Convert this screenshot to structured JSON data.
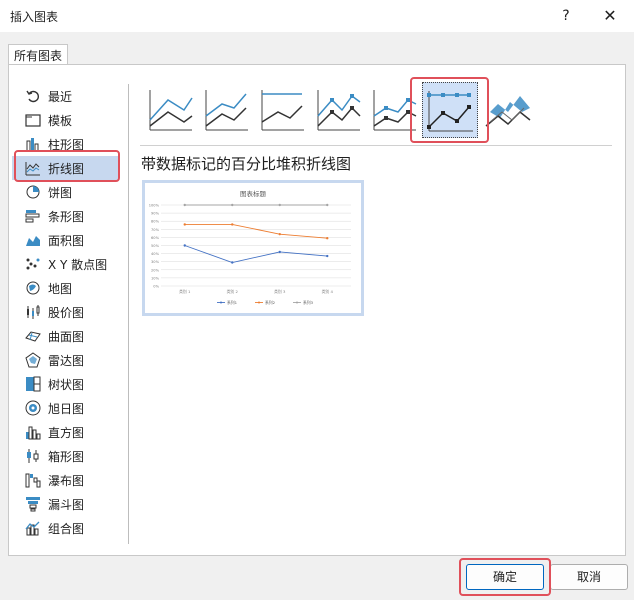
{
  "window": {
    "title": "插入图表",
    "help_label": "?",
    "close_label": "✕"
  },
  "tabs": [
    {
      "label": "所有图表"
    }
  ],
  "sidebar": {
    "items": [
      {
        "label": "最近",
        "icon": "recent-icon"
      },
      {
        "label": "模板",
        "icon": "folder-icon"
      },
      {
        "label": "柱形图",
        "icon": "column-chart-icon"
      },
      {
        "label": "折线图",
        "icon": "line-chart-icon",
        "selected": true
      },
      {
        "label": "饼图",
        "icon": "pie-chart-icon"
      },
      {
        "label": "条形图",
        "icon": "bar-chart-icon"
      },
      {
        "label": "面积图",
        "icon": "area-chart-icon"
      },
      {
        "label": "X Y 散点图",
        "icon": "scatter-chart-icon"
      },
      {
        "label": "地图",
        "icon": "map-chart-icon"
      },
      {
        "label": "股价图",
        "icon": "stock-chart-icon"
      },
      {
        "label": "曲面图",
        "icon": "surface-chart-icon"
      },
      {
        "label": "雷达图",
        "icon": "radar-chart-icon"
      },
      {
        "label": "树状图",
        "icon": "treemap-chart-icon"
      },
      {
        "label": "旭日图",
        "icon": "sunburst-chart-icon"
      },
      {
        "label": "直方图",
        "icon": "histogram-chart-icon"
      },
      {
        "label": "箱形图",
        "icon": "box-whisker-chart-icon"
      },
      {
        "label": "瀑布图",
        "icon": "waterfall-chart-icon"
      },
      {
        "label": "漏斗图",
        "icon": "funnel-chart-icon"
      },
      {
        "label": "组合图",
        "icon": "combo-chart-icon"
      }
    ]
  },
  "subtypes": [
    {
      "icon": "line-subtype-icon"
    },
    {
      "icon": "stacked-line-subtype-icon"
    },
    {
      "icon": "percent-stacked-line-subtype-icon"
    },
    {
      "icon": "line-markers-subtype-icon"
    },
    {
      "icon": "stacked-line-markers-subtype-icon"
    },
    {
      "icon": "percent-stacked-line-markers-subtype-icon",
      "selected": true
    },
    {
      "icon": "3d-line-subtype-icon"
    }
  ],
  "selected_chart_title": "带数据标记的百分比堆积折线图",
  "chart_data": {
    "type": "line",
    "title": "图表标题",
    "categories": [
      "类别 1",
      "类别 2",
      "类别 3",
      "类别 4"
    ],
    "ylim": [
      0,
      1
    ],
    "y_ticks": [
      "0%",
      "10%",
      "20%",
      "30%",
      "40%",
      "50%",
      "60%",
      "70%",
      "80%",
      "90%",
      "100%"
    ],
    "series": [
      {
        "name": "系列1",
        "color": "#4472c4",
        "values": [
          0.5,
          0.29,
          0.42,
          0.37
        ]
      },
      {
        "name": "系列2",
        "color": "#ed7d31",
        "values": [
          0.76,
          0.76,
          0.64,
          0.59
        ]
      },
      {
        "name": "系列3",
        "color": "#a5a5a5",
        "values": [
          1.0,
          1.0,
          1.0,
          1.0
        ]
      }
    ],
    "grid": true,
    "legend": "bottom"
  },
  "buttons": {
    "ok": "确定",
    "cancel": "取消"
  }
}
